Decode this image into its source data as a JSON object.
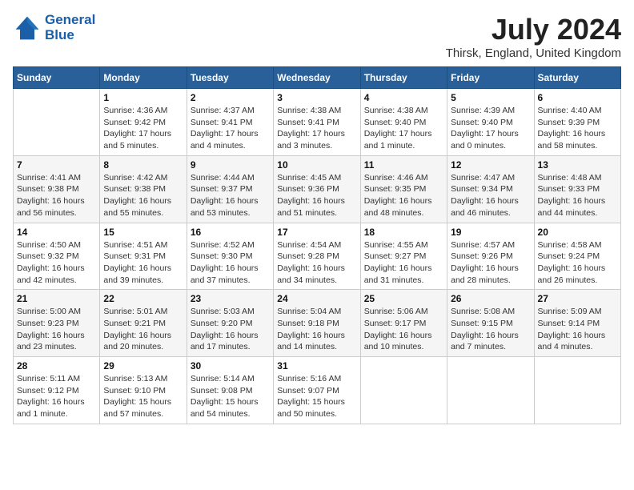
{
  "header": {
    "logo_line1": "General",
    "logo_line2": "Blue",
    "month_year": "July 2024",
    "location": "Thirsk, England, United Kingdom"
  },
  "weekdays": [
    "Sunday",
    "Monday",
    "Tuesday",
    "Wednesday",
    "Thursday",
    "Friday",
    "Saturday"
  ],
  "weeks": [
    [
      {
        "day": "",
        "sunrise": "",
        "sunset": "",
        "daylight": ""
      },
      {
        "day": "1",
        "sunrise": "Sunrise: 4:36 AM",
        "sunset": "Sunset: 9:42 PM",
        "daylight": "Daylight: 17 hours and 5 minutes."
      },
      {
        "day": "2",
        "sunrise": "Sunrise: 4:37 AM",
        "sunset": "Sunset: 9:41 PM",
        "daylight": "Daylight: 17 hours and 4 minutes."
      },
      {
        "day": "3",
        "sunrise": "Sunrise: 4:38 AM",
        "sunset": "Sunset: 9:41 PM",
        "daylight": "Daylight: 17 hours and 3 minutes."
      },
      {
        "day": "4",
        "sunrise": "Sunrise: 4:38 AM",
        "sunset": "Sunset: 9:40 PM",
        "daylight": "Daylight: 17 hours and 1 minute."
      },
      {
        "day": "5",
        "sunrise": "Sunrise: 4:39 AM",
        "sunset": "Sunset: 9:40 PM",
        "daylight": "Daylight: 17 hours and 0 minutes."
      },
      {
        "day": "6",
        "sunrise": "Sunrise: 4:40 AM",
        "sunset": "Sunset: 9:39 PM",
        "daylight": "Daylight: 16 hours and 58 minutes."
      }
    ],
    [
      {
        "day": "7",
        "sunrise": "Sunrise: 4:41 AM",
        "sunset": "Sunset: 9:38 PM",
        "daylight": "Daylight: 16 hours and 56 minutes."
      },
      {
        "day": "8",
        "sunrise": "Sunrise: 4:42 AM",
        "sunset": "Sunset: 9:38 PM",
        "daylight": "Daylight: 16 hours and 55 minutes."
      },
      {
        "day": "9",
        "sunrise": "Sunrise: 4:44 AM",
        "sunset": "Sunset: 9:37 PM",
        "daylight": "Daylight: 16 hours and 53 minutes."
      },
      {
        "day": "10",
        "sunrise": "Sunrise: 4:45 AM",
        "sunset": "Sunset: 9:36 PM",
        "daylight": "Daylight: 16 hours and 51 minutes."
      },
      {
        "day": "11",
        "sunrise": "Sunrise: 4:46 AM",
        "sunset": "Sunset: 9:35 PM",
        "daylight": "Daylight: 16 hours and 48 minutes."
      },
      {
        "day": "12",
        "sunrise": "Sunrise: 4:47 AM",
        "sunset": "Sunset: 9:34 PM",
        "daylight": "Daylight: 16 hours and 46 minutes."
      },
      {
        "day": "13",
        "sunrise": "Sunrise: 4:48 AM",
        "sunset": "Sunset: 9:33 PM",
        "daylight": "Daylight: 16 hours and 44 minutes."
      }
    ],
    [
      {
        "day": "14",
        "sunrise": "Sunrise: 4:50 AM",
        "sunset": "Sunset: 9:32 PM",
        "daylight": "Daylight: 16 hours and 42 minutes."
      },
      {
        "day": "15",
        "sunrise": "Sunrise: 4:51 AM",
        "sunset": "Sunset: 9:31 PM",
        "daylight": "Daylight: 16 hours and 39 minutes."
      },
      {
        "day": "16",
        "sunrise": "Sunrise: 4:52 AM",
        "sunset": "Sunset: 9:30 PM",
        "daylight": "Daylight: 16 hours and 37 minutes."
      },
      {
        "day": "17",
        "sunrise": "Sunrise: 4:54 AM",
        "sunset": "Sunset: 9:28 PM",
        "daylight": "Daylight: 16 hours and 34 minutes."
      },
      {
        "day": "18",
        "sunrise": "Sunrise: 4:55 AM",
        "sunset": "Sunset: 9:27 PM",
        "daylight": "Daylight: 16 hours and 31 minutes."
      },
      {
        "day": "19",
        "sunrise": "Sunrise: 4:57 AM",
        "sunset": "Sunset: 9:26 PM",
        "daylight": "Daylight: 16 hours and 28 minutes."
      },
      {
        "day": "20",
        "sunrise": "Sunrise: 4:58 AM",
        "sunset": "Sunset: 9:24 PM",
        "daylight": "Daylight: 16 hours and 26 minutes."
      }
    ],
    [
      {
        "day": "21",
        "sunrise": "Sunrise: 5:00 AM",
        "sunset": "Sunset: 9:23 PM",
        "daylight": "Daylight: 16 hours and 23 minutes."
      },
      {
        "day": "22",
        "sunrise": "Sunrise: 5:01 AM",
        "sunset": "Sunset: 9:21 PM",
        "daylight": "Daylight: 16 hours and 20 minutes."
      },
      {
        "day": "23",
        "sunrise": "Sunrise: 5:03 AM",
        "sunset": "Sunset: 9:20 PM",
        "daylight": "Daylight: 16 hours and 17 minutes."
      },
      {
        "day": "24",
        "sunrise": "Sunrise: 5:04 AM",
        "sunset": "Sunset: 9:18 PM",
        "daylight": "Daylight: 16 hours and 14 minutes."
      },
      {
        "day": "25",
        "sunrise": "Sunrise: 5:06 AM",
        "sunset": "Sunset: 9:17 PM",
        "daylight": "Daylight: 16 hours and 10 minutes."
      },
      {
        "day": "26",
        "sunrise": "Sunrise: 5:08 AM",
        "sunset": "Sunset: 9:15 PM",
        "daylight": "Daylight: 16 hours and 7 minutes."
      },
      {
        "day": "27",
        "sunrise": "Sunrise: 5:09 AM",
        "sunset": "Sunset: 9:14 PM",
        "daylight": "Daylight: 16 hours and 4 minutes."
      }
    ],
    [
      {
        "day": "28",
        "sunrise": "Sunrise: 5:11 AM",
        "sunset": "Sunset: 9:12 PM",
        "daylight": "Daylight: 16 hours and 1 minute."
      },
      {
        "day": "29",
        "sunrise": "Sunrise: 5:13 AM",
        "sunset": "Sunset: 9:10 PM",
        "daylight": "Daylight: 15 hours and 57 minutes."
      },
      {
        "day": "30",
        "sunrise": "Sunrise: 5:14 AM",
        "sunset": "Sunset: 9:08 PM",
        "daylight": "Daylight: 15 hours and 54 minutes."
      },
      {
        "day": "31",
        "sunrise": "Sunrise: 5:16 AM",
        "sunset": "Sunset: 9:07 PM",
        "daylight": "Daylight: 15 hours and 50 minutes."
      },
      {
        "day": "",
        "sunrise": "",
        "sunset": "",
        "daylight": ""
      },
      {
        "day": "",
        "sunrise": "",
        "sunset": "",
        "daylight": ""
      },
      {
        "day": "",
        "sunrise": "",
        "sunset": "",
        "daylight": ""
      }
    ]
  ]
}
